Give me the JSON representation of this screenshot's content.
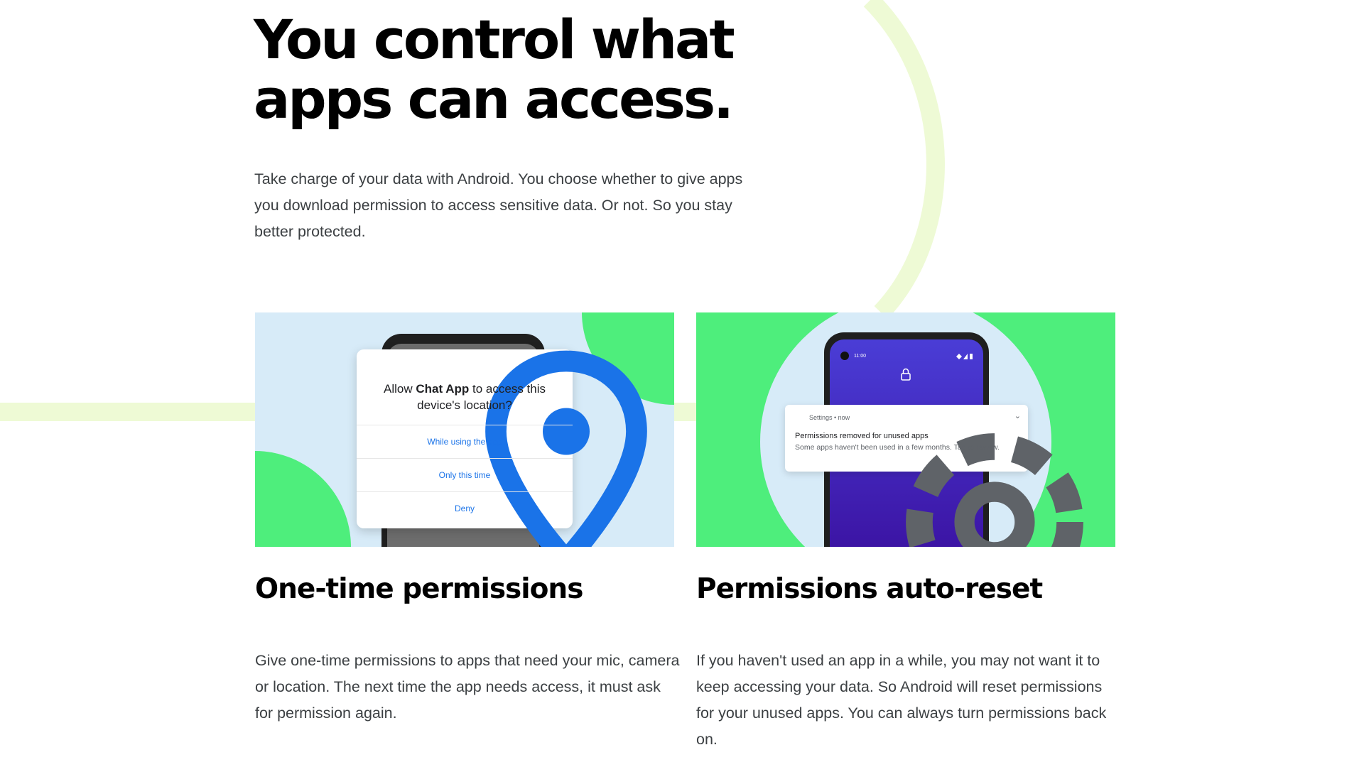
{
  "hero": {
    "title_line1": "You control what",
    "title_line2": "apps can access.",
    "body": "Take charge of your data with Android. You choose whether to give apps you download permission to access sensitive data. Or not. So you stay better protected."
  },
  "cards": [
    {
      "title": "One-time permissions",
      "body": "Give one-time permissions to apps that need your mic, camera or location. The next time the app needs access, it must ask for permission again.",
      "dialog": {
        "prompt_prefix": "Allow ",
        "app_name": "Chat App",
        "prompt_suffix": " to access this device's location?",
        "options": [
          "While using the app",
          "Only this time",
          "Deny"
        ]
      }
    },
    {
      "title": "Permissions auto-reset",
      "body": "If you haven't used an app in a while, you may not want it to keep accessing your data. So Android will reset permissions for your unused apps. You can always turn permissions back on.",
      "phone": {
        "status_time": "11:00"
      },
      "notification": {
        "app": "Settings • now",
        "title": "Permissions removed for unused apps",
        "text": "Some apps haven't been used in a few months. Tap to review."
      }
    }
  ],
  "colors": {
    "green": "#4eee7c",
    "light_blue": "#d7ebf8",
    "deco_line": "#eefad5",
    "link_blue": "#1a73e8",
    "phone_purple": "#3a1ab0"
  },
  "icons": [
    "location-pin-icon",
    "lock-icon",
    "gear-icon",
    "chevron-down-icon",
    "wifi-icon",
    "signal-icon",
    "battery-icon"
  ]
}
